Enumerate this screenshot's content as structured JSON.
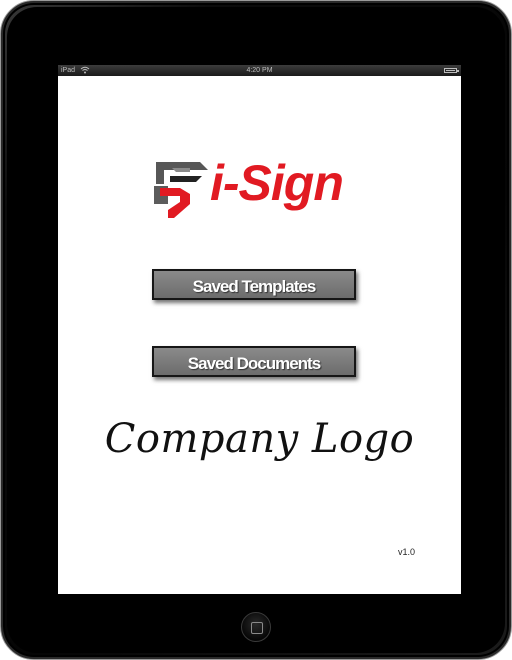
{
  "status_bar": {
    "carrier": "iPad",
    "time": "4:20 PM"
  },
  "app": {
    "logo_text": "i-Sign",
    "brand_color": "#e11a22"
  },
  "menu": {
    "saved_templates_label": "Saved Templates",
    "saved_documents_label": "Saved Documents"
  },
  "company_logo_text": "Company Logo",
  "version": "v1.0",
  "icons": {
    "wifi": "wifi-icon",
    "battery": "battery-icon",
    "home": "home-button-icon"
  }
}
